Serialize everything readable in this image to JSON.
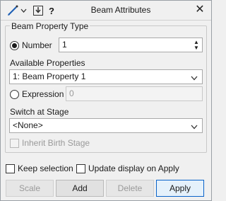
{
  "title": "Beam Attributes",
  "toolbar": {
    "draw_icon": "pencil-line-icon",
    "dropdown_icon": "chevron-down-icon",
    "import_icon": "download-arrow-icon",
    "help_label": "?"
  },
  "close_label": "✕",
  "group": {
    "legend": "Beam Property Type",
    "number_label": "Number",
    "number_value": "1",
    "available_properties_label": "Available Properties",
    "available_properties_value": "1: Beam Property 1",
    "expression_label": "Expression",
    "expression_value": "0",
    "switch_stage_label": "Switch at Stage",
    "switch_stage_value": "<None>",
    "inherit_birth_label": "Inherit Birth Stage"
  },
  "options": {
    "keep_selection_label": "Keep selection",
    "update_display_label": "Update display on Apply"
  },
  "buttons": {
    "scale": "Scale",
    "add": "Add",
    "delete": "Delete",
    "apply": "Apply"
  },
  "colors": {
    "accent": "#0a63c9",
    "disabled_text": "#9a9a9a"
  }
}
